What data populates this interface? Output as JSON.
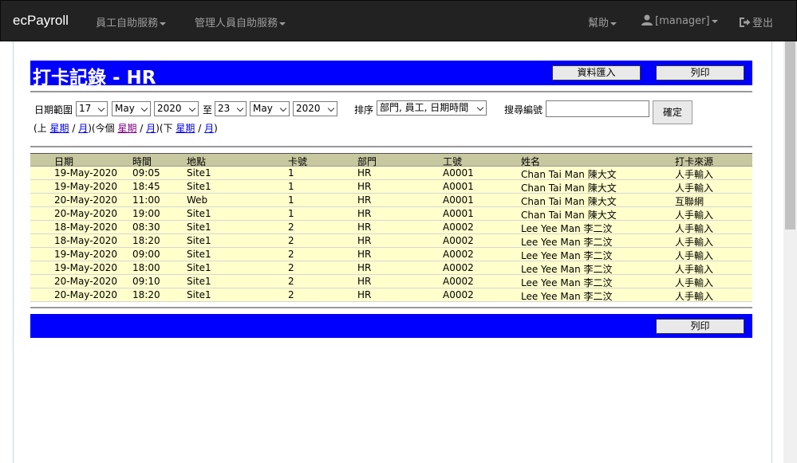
{
  "navbar": {
    "brand": "ecPayroll",
    "menu_employee": "員工自助服務",
    "menu_manager": "管理人員自助服務",
    "help": "幫助",
    "user": "[manager]",
    "logout": "登出"
  },
  "page": {
    "title": "打卡記錄 - HR",
    "import_label": "資料匯入",
    "print_label": "列印"
  },
  "filter": {
    "date_range_label": "日期範圍",
    "from_day": "17",
    "from_month": "May",
    "from_year": "2020",
    "to_label": "至",
    "to_day": "23",
    "to_month": "May",
    "to_year": "2020",
    "sort_label": "排序",
    "sort_value": "部門, 員工, 日期時間",
    "search_label": "搜尋編號",
    "search_value": "",
    "confirm_label": "確定"
  },
  "period_nav": {
    "prev_open": "(上",
    "prev_week": "星期",
    "sep1": "/",
    "prev_month": "月",
    "this_open": ")(今個",
    "this_week": "星期",
    "sep2": "/",
    "this_month": "月",
    "next_open": ")(下",
    "next_week": "星期",
    "sep3": "/",
    "next_month": "月",
    "close": ")"
  },
  "table": {
    "headers": [
      "日期",
      "時間",
      "地點",
      "卡號",
      "部門",
      "工號",
      "姓名",
      "打卡來源"
    ],
    "rows": [
      [
        "19-May-2020",
        "09:05",
        "Site1",
        "1",
        "HR",
        "A0001",
        "Chan Tai Man 陳大文",
        "人手輸入"
      ],
      [
        "19-May-2020",
        "18:45",
        "Site1",
        "1",
        "HR",
        "A0001",
        "Chan Tai Man 陳大文",
        "人手輸入"
      ],
      [
        "20-May-2020",
        "11:00",
        "Web",
        "1",
        "HR",
        "A0001",
        "Chan Tai Man 陳大文",
        "互聯網"
      ],
      [
        "20-May-2020",
        "19:00",
        "Site1",
        "1",
        "HR",
        "A0001",
        "Chan Tai Man 陳大文",
        "人手輸入"
      ],
      [
        "18-May-2020",
        "08:30",
        "Site1",
        "2",
        "HR",
        "A0002",
        "Lee Yee Man 李二汶",
        "人手輸入"
      ],
      [
        "18-May-2020",
        "18:20",
        "Site1",
        "2",
        "HR",
        "A0002",
        "Lee Yee Man 李二汶",
        "人手輸入"
      ],
      [
        "19-May-2020",
        "09:00",
        "Site1",
        "2",
        "HR",
        "A0002",
        "Lee Yee Man 李二汶",
        "人手輸入"
      ],
      [
        "19-May-2020",
        "18:00",
        "Site1",
        "2",
        "HR",
        "A0002",
        "Lee Yee Man 李二汶",
        "人手輸入"
      ],
      [
        "20-May-2020",
        "09:10",
        "Site1",
        "2",
        "HR",
        "A0002",
        "Lee Yee Man 李二汶",
        "人手輸入"
      ],
      [
        "20-May-2020",
        "18:20",
        "Site1",
        "2",
        "HR",
        "A0002",
        "Lee Yee Man 李二汶",
        "人手輸入"
      ]
    ]
  },
  "colors": {
    "navbar_bg": "#222222",
    "title_bar": "#0000ff",
    "row_bg": "#ffffcc",
    "header_bg": "#c8c8a0"
  },
  "icons": {
    "user": "user-icon",
    "logout": "logout-icon"
  }
}
